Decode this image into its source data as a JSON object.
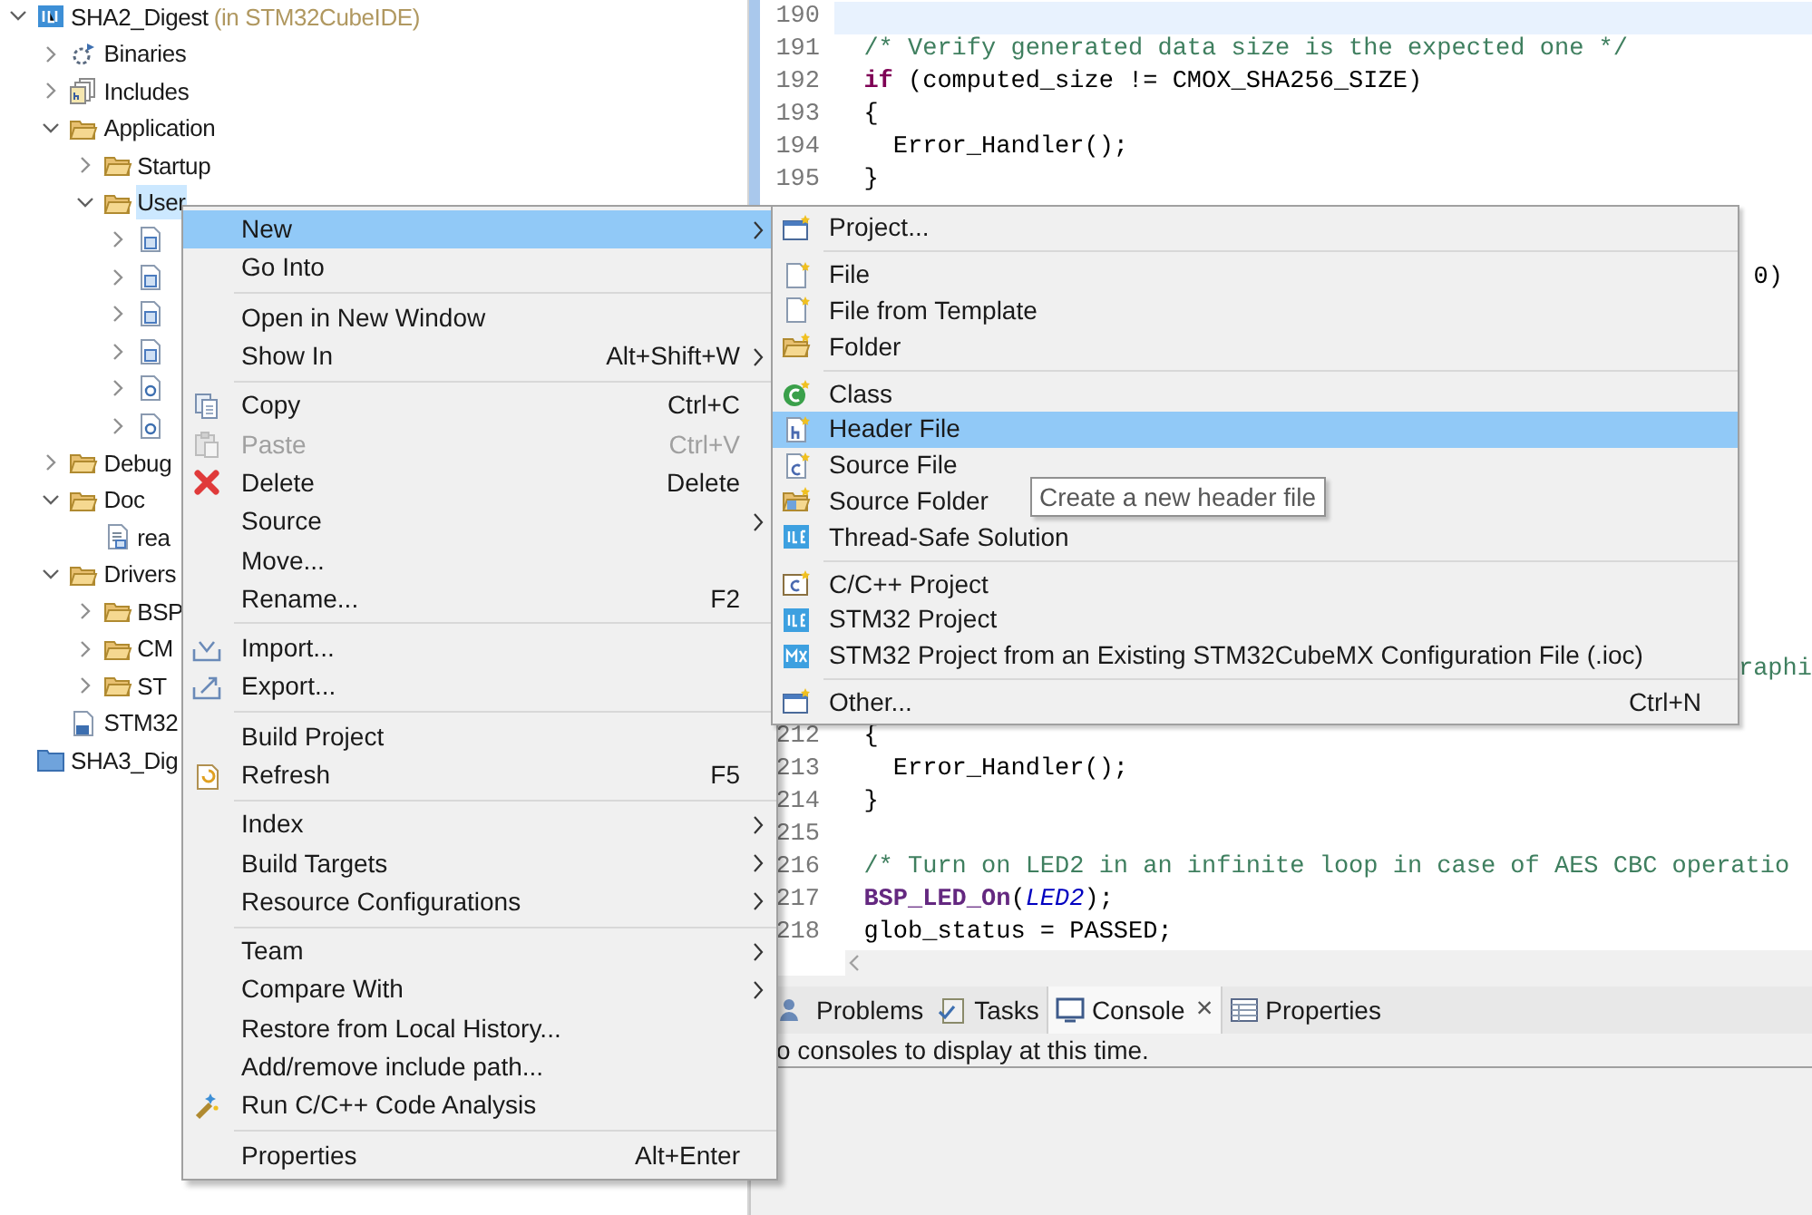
{
  "project_tree": [
    {
      "label": "SHA2_Digest",
      "suffix": "(in STM32CubeIDE)",
      "kind": "project",
      "expanded": true,
      "selected": false,
      "children": [
        {
          "label": "Binaries",
          "kind": "binaries",
          "expanded": false,
          "selected": false
        },
        {
          "label": "Includes",
          "kind": "includes",
          "expanded": false,
          "selected": false
        },
        {
          "label": "Application",
          "kind": "folder",
          "expanded": true,
          "selected": false,
          "children": [
            {
              "label": "Startup",
              "kind": "folder",
              "expanded": false,
              "selected": false
            },
            {
              "label": "User",
              "kind": "folder",
              "expanded": true,
              "selected": true,
              "children": [
                {
                  "kind": "source",
                  "expanded": false
                },
                {
                  "kind": "source",
                  "expanded": false
                },
                {
                  "kind": "source",
                  "expanded": false
                },
                {
                  "kind": "source",
                  "expanded": false
                },
                {
                  "kind": "c-file",
                  "expanded": false
                },
                {
                  "kind": "c-file",
                  "expanded": false
                }
              ]
            }
          ]
        },
        {
          "label": "Debug",
          "kind": "folder",
          "expanded": false,
          "selected": false
        },
        {
          "label": "Doc",
          "kind": "folder",
          "expanded": true,
          "selected": false,
          "children": [
            {
              "label": "rea",
              "kind": "text-file",
              "selected": false
            }
          ]
        },
        {
          "label": "Drivers",
          "kind": "folder",
          "expanded": true,
          "selected": false,
          "children": [
            {
              "label": "BSP",
              "kind": "folder",
              "expanded": false,
              "selected": false
            },
            {
              "label": "CM",
              "kind": "folder",
              "expanded": false,
              "selected": false
            },
            {
              "label": "ST",
              "kind": "folder",
              "expanded": false,
              "selected": false
            }
          ]
        },
        {
          "label": "STM32",
          "kind": "ld-file",
          "selected": false
        }
      ]
    },
    {
      "label": "SHA3_Dig",
      "kind": "closed-project",
      "selected": false
    }
  ],
  "editor": {
    "top_lines": [
      {
        "number": "190",
        "current": true
      },
      {
        "number": "191",
        "current": false,
        "segments": [
          {
            "kind": "comment",
            "text": "  /* Verify generated data size is the expected one */"
          }
        ]
      },
      {
        "number": "192",
        "current": false,
        "segments": [
          {
            "kind": "keyword",
            "text": "  if"
          },
          {
            "kind": "plain",
            "text": " (computed_size != CMOX_SHA256_SIZE)"
          }
        ]
      },
      {
        "number": "193",
        "current": false,
        "segments": [
          {
            "kind": "plain",
            "text": "  {"
          }
        ]
      },
      {
        "number": "194",
        "current": false,
        "segments": [
          {
            "kind": "plain",
            "text": "    Error_Handler();"
          }
        ]
      },
      {
        "number": "195",
        "current": false,
        "segments": [
          {
            "kind": "plain",
            "text": "  }"
          }
        ]
      }
    ],
    "fragments": [
      {
        "kind": "plain",
        "text": "0)"
      },
      {
        "kind": "comment",
        "text": "raphi"
      }
    ],
    "bottom_lines": [
      {
        "number": "212",
        "current": false,
        "segments": [
          {
            "kind": "plain",
            "text": "  {"
          }
        ]
      },
      {
        "number": "213",
        "current": false,
        "segments": [
          {
            "kind": "plain",
            "text": "    Error_Handler();"
          }
        ]
      },
      {
        "number": "214",
        "current": false,
        "segments": [
          {
            "kind": "plain",
            "text": "  }"
          }
        ]
      },
      {
        "number": "215",
        "current": false
      },
      {
        "number": "216",
        "current": false,
        "segments": [
          {
            "kind": "comment",
            "text": "  /* Turn on LED2 in an infinite loop in case of AES CBC operatio"
          }
        ]
      },
      {
        "number": "217",
        "current": false,
        "segments": [
          {
            "kind": "function",
            "text": "  BSP_LED_On"
          },
          {
            "kind": "plain",
            "text": "("
          },
          {
            "kind": "constant",
            "text": "LED2"
          },
          {
            "kind": "plain",
            "text": ");"
          }
        ]
      },
      {
        "number": "218",
        "current": false,
        "segments": [
          {
            "kind": "plain",
            "text": "  glob_status = PASSED;"
          }
        ]
      }
    ]
  },
  "bottom_panel": {
    "tabs": [
      {
        "label": "Problems",
        "kind": "problems",
        "selected": false
      },
      {
        "label": "Tasks",
        "kind": "tasks",
        "selected": false
      },
      {
        "label": "Console",
        "kind": "console",
        "selected": true,
        "closable": true,
        "close": "×"
      },
      {
        "label": "Properties",
        "kind": "properties",
        "selected": false
      }
    ],
    "message": "o consoles to display at this time."
  },
  "context_menu": {
    "groups": [
      [
        {
          "label": "New",
          "kind": "plain",
          "submenu": true,
          "selected": true,
          "disabled": false
        },
        {
          "label": "Go Into",
          "kind": "plain",
          "selected": false,
          "disabled": false
        }
      ],
      [
        {
          "label": "Open in New Window",
          "kind": "plain",
          "selected": false,
          "disabled": false
        },
        {
          "label": "Show In",
          "kind": "plain",
          "shortcut": "Alt+Shift+W",
          "submenu": true,
          "selected": false,
          "disabled": false
        }
      ],
      [
        {
          "label": "Copy",
          "kind": "copy",
          "shortcut": "Ctrl+C",
          "selected": false,
          "disabled": false
        },
        {
          "label": "Paste",
          "kind": "paste",
          "shortcut": "Ctrl+V",
          "selected": false,
          "disabled": true
        },
        {
          "label": "Delete",
          "kind": "delete",
          "shortcut": "Delete",
          "selected": false,
          "disabled": false
        },
        {
          "label": "Source",
          "kind": "plain",
          "submenu": true,
          "selected": false,
          "disabled": false
        },
        {
          "label": "Move...",
          "kind": "plain",
          "selected": false,
          "disabled": false
        },
        {
          "label": "Rename...",
          "kind": "plain",
          "shortcut": "F2",
          "selected": false,
          "disabled": false
        }
      ],
      [
        {
          "label": "Import...",
          "kind": "import",
          "selected": false,
          "disabled": false
        },
        {
          "label": "Export...",
          "kind": "export",
          "selected": false,
          "disabled": false
        }
      ],
      [
        {
          "label": "Build Project",
          "kind": "plain",
          "selected": false,
          "disabled": false
        },
        {
          "label": "Refresh",
          "kind": "refresh",
          "shortcut": "F5",
          "selected": false,
          "disabled": false
        }
      ],
      [
        {
          "label": "Index",
          "kind": "plain",
          "submenu": true,
          "selected": false,
          "disabled": false
        },
        {
          "label": "Build Targets",
          "kind": "plain",
          "submenu": true,
          "selected": false,
          "disabled": false
        },
        {
          "label": "Resource Configurations",
          "kind": "plain",
          "submenu": true,
          "selected": false,
          "disabled": false
        }
      ],
      [
        {
          "label": "Team",
          "kind": "plain",
          "submenu": true,
          "selected": false,
          "disabled": false
        },
        {
          "label": "Compare With",
          "kind": "plain",
          "submenu": true,
          "selected": false,
          "disabled": false
        },
        {
          "label": "Restore from Local History...",
          "kind": "plain",
          "selected": false,
          "disabled": false
        },
        {
          "label": "Add/remove include path...",
          "kind": "plain",
          "selected": false,
          "disabled": false
        },
        {
          "label": "Run C/C++ Code Analysis",
          "kind": "analysis",
          "selected": false,
          "disabled": false
        }
      ],
      [
        {
          "label": "Properties",
          "kind": "plain",
          "shortcut": "Alt+Enter",
          "selected": false,
          "disabled": false
        }
      ]
    ]
  },
  "submenu": {
    "groups": [
      [
        {
          "label": "Project...",
          "kind": "new-project",
          "selected": false
        }
      ],
      [
        {
          "label": "File",
          "kind": "new-file",
          "selected": false
        },
        {
          "label": "File from Template",
          "kind": "new-file",
          "selected": false
        },
        {
          "label": "Folder",
          "kind": "new-folder",
          "selected": false
        }
      ],
      [
        {
          "label": "Class",
          "kind": "class",
          "selected": false
        },
        {
          "label": "Header File",
          "kind": "header",
          "selected": true
        },
        {
          "label": "Source File",
          "kind": "source-file",
          "selected": false
        },
        {
          "label": "Source Folder",
          "kind": "source-folder",
          "selected": false
        },
        {
          "label": "Thread-Safe Solution",
          "kind": "ide",
          "selected": false
        }
      ],
      [
        {
          "label": "C/C++ Project",
          "kind": "cpp-project",
          "selected": false
        },
        {
          "label": "STM32 Project",
          "kind": "ide",
          "selected": false
        },
        {
          "label": "STM32 Project from an Existing STM32CubeMX Configuration File (.ioc)",
          "kind": "mx",
          "selected": false
        }
      ],
      [
        {
          "label": "Other...",
          "kind": "new-project",
          "shortcut": "Ctrl+N",
          "selected": false
        }
      ]
    ]
  },
  "tooltip": "Create a new header file"
}
